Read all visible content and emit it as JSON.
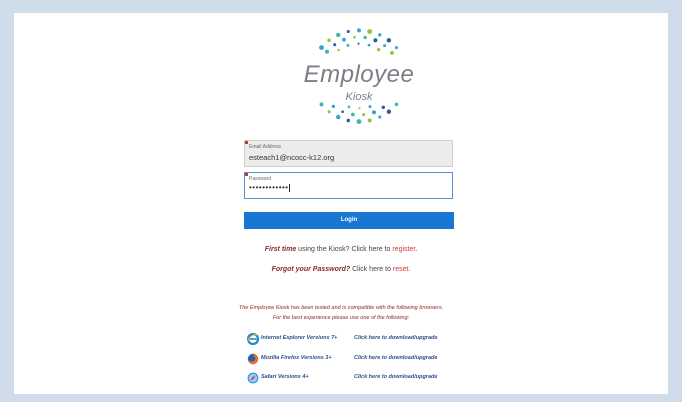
{
  "logo": {
    "title": "Employee",
    "subtitle": "Kiosk",
    "dot_colors": [
      "#2e5aa8",
      "#3aa3d6",
      "#8cc63f",
      "#3fb8a8"
    ]
  },
  "form": {
    "email": {
      "label": "Email Address",
      "value": "esteach1@ncocc-k12.org"
    },
    "password": {
      "label": "Password",
      "masked_value": "••••••••••••"
    },
    "login_label": "Login"
  },
  "links": {
    "first_time": {
      "emphasis": "First time",
      "text": " using the Kiosk? Click here to ",
      "link": "register",
      "tail": "."
    },
    "forgot": {
      "emphasis": "Forgot your Password?",
      "text": " Click here to ",
      "link": "reset",
      "tail": "."
    }
  },
  "compatibility": {
    "line1": "The Employee Kiosk has been tested and is compatible with the following browsers.",
    "line2": "For the best experience please use one of the following:"
  },
  "browsers": [
    {
      "name": "Internet Explorer Versions 7+",
      "link": "Click here to download/upgrade",
      "icon": "internet-explorer-icon"
    },
    {
      "name": "Mozilla Firefox Versions 3+",
      "link": "Click here to download/upgrade",
      "icon": "firefox-icon"
    },
    {
      "name": "Safari Versions 4+",
      "link": "Click here to download/upgrade",
      "icon": "safari-icon"
    }
  ],
  "colors": {
    "page_background": "#cfdcea",
    "login_button": "#1877d2",
    "emphasis": "#8b2a2a",
    "link": "#d23a3a",
    "browser_text": "#2a4e8a"
  }
}
